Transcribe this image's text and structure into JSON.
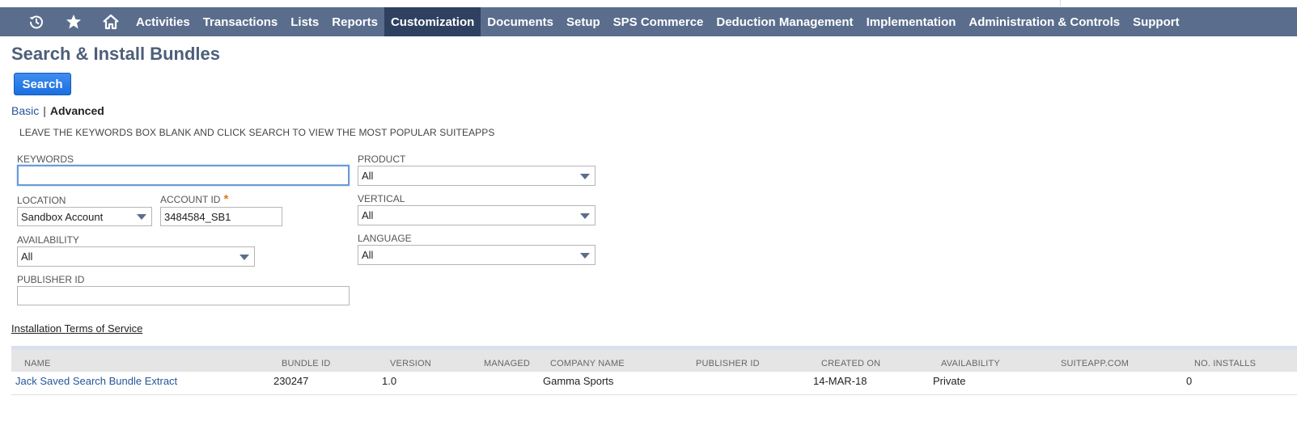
{
  "nav": {
    "icons": [
      "recent-icon",
      "star-icon",
      "home-icon"
    ],
    "items": [
      {
        "label": "Activities"
      },
      {
        "label": "Transactions"
      },
      {
        "label": "Lists"
      },
      {
        "label": "Reports"
      },
      {
        "label": "Customization",
        "active": true
      },
      {
        "label": "Documents"
      },
      {
        "label": "Setup"
      },
      {
        "label": "SPS Commerce"
      },
      {
        "label": "Deduction Management"
      },
      {
        "label": "Implementation"
      },
      {
        "label": "Administration & Controls"
      },
      {
        "label": "Support"
      }
    ],
    "bg_color": "#5a6d8d",
    "active_color": "#2f4161"
  },
  "page": {
    "title": "Search & Install Bundles",
    "search_button": "Search",
    "mode_basic": "Basic",
    "mode_separator": "|",
    "mode_advanced": "Advanced",
    "hint": "LEAVE THE KEYWORDS BOX BLANK AND CLICK SEARCH TO VIEW THE MOST POPULAR SUITEAPPS"
  },
  "form": {
    "keywords": {
      "label": "KEYWORDS",
      "value": ""
    },
    "location": {
      "label": "LOCATION",
      "value": "Sandbox Account"
    },
    "account_id": {
      "label": "ACCOUNT ID",
      "required_mark": "*",
      "value": "3484584_SB1"
    },
    "availability": {
      "label": "AVAILABILITY",
      "value": "All"
    },
    "publisher_id": {
      "label": "PUBLISHER ID",
      "value": ""
    },
    "product": {
      "label": "PRODUCT",
      "value": "All"
    },
    "vertical": {
      "label": "VERTICAL",
      "value": "All"
    },
    "language": {
      "label": "LANGUAGE",
      "value": "All"
    }
  },
  "terms_link": "Installation Terms of Service",
  "results": {
    "columns": [
      "NAME",
      "BUNDLE ID",
      "VERSION",
      "MANAGED",
      "COMPANY NAME",
      "PUBLISHER ID",
      "CREATED ON",
      "AVAILABILITY",
      "SUITEAPP.COM",
      "NO. INSTALLS"
    ],
    "rows": [
      {
        "name": "Jack Saved Search Bundle Extract",
        "bundle_id": "230247",
        "version": "1.0",
        "managed": "",
        "company": "Gamma Sports",
        "publisher_id": "",
        "created_on": "14-MAR-18",
        "availability": "Private",
        "suiteapp": "",
        "installs": "0"
      }
    ]
  }
}
